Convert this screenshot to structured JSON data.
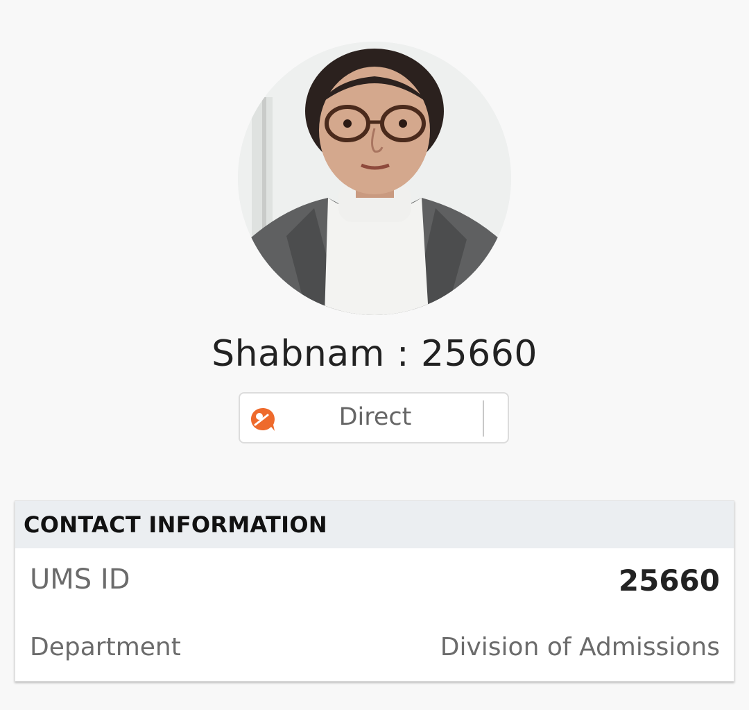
{
  "profile": {
    "name_title": "Shabnam : 25660",
    "avatar_icon": "profile-photo"
  },
  "direct_button": {
    "label": "Direct",
    "icon": "chat-bubble-icon",
    "icon_color": "#ee6a2c"
  },
  "contact_info": {
    "header": "CONTACT INFORMATION",
    "rows": [
      {
        "label": "UMS ID",
        "value": "25660"
      },
      {
        "label": "Department",
        "value": "Division of Admissions"
      }
    ]
  }
}
